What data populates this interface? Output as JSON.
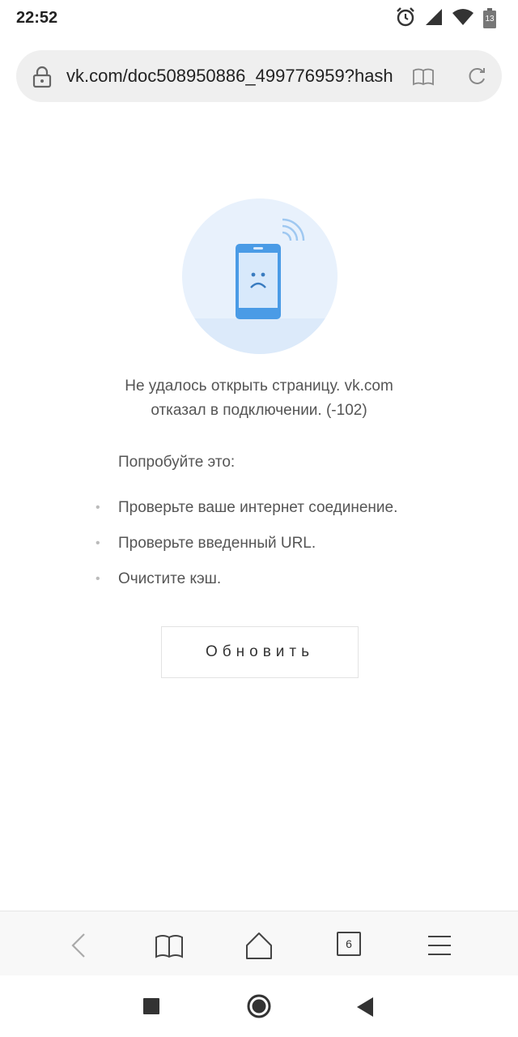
{
  "status_bar": {
    "time": "22:52",
    "battery_level": "13",
    "icons": [
      "alarm-icon",
      "signal-icon",
      "wifi-icon",
      "battery-icon"
    ]
  },
  "url_bar": {
    "url": "vk.com/doc508950886_499776959?hash",
    "icons": [
      "lock-icon",
      "reader-mode-icon",
      "reload-icon"
    ]
  },
  "error_page": {
    "message_line1": "Не удалось открыть страницу. vk.com",
    "message_line2": "отказал в подключении. (-102)",
    "try_label": "Попробуйте это:",
    "tips": [
      "Проверьте ваше интернет соединение.",
      "Проверьте введенный URL.",
      "Очистите кэш."
    ],
    "refresh_label": "Обновить"
  },
  "toolbar": {
    "tabs_count": "6",
    "icons": [
      "back-icon",
      "bookmarks-icon",
      "home-icon",
      "tabs-icon",
      "menu-icon"
    ]
  },
  "nav_bar": {
    "icons": [
      "recents-icon",
      "home-circle-icon",
      "back-triangle-icon"
    ]
  },
  "colors": {
    "illustration_bg": "#e8f1fc",
    "phone_blue": "#4a9be6",
    "url_bar_bg": "#efefef"
  }
}
